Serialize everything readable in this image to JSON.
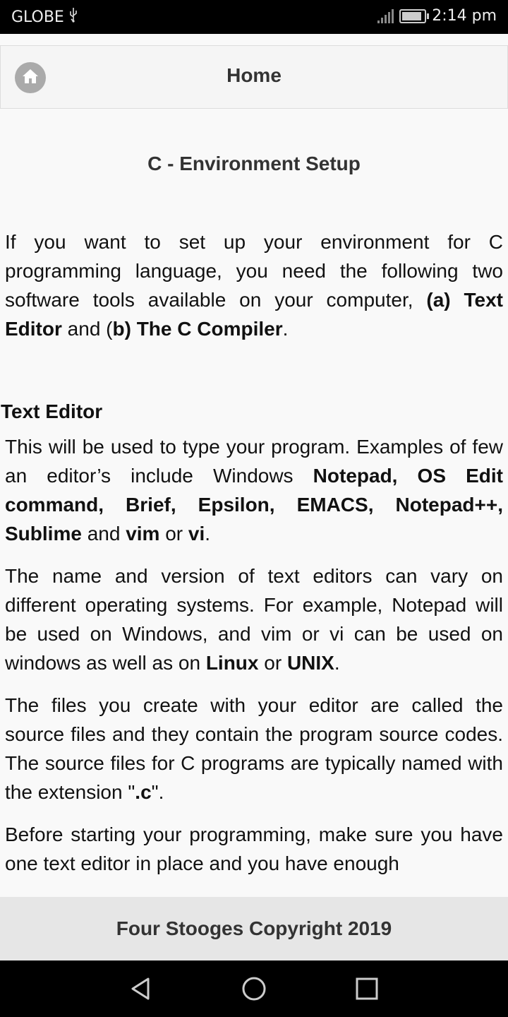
{
  "status_bar": {
    "carrier": "GLOBE",
    "time": "2:14 pm",
    "battery_level": 0.9
  },
  "header": {
    "title": "Home",
    "home_icon": "home-icon"
  },
  "article": {
    "title": "C - Environment Setup",
    "intro": {
      "t1": "If you want to set up your environment for C programming language, you need the following two software tools available on your computer, ",
      "b1": "(a) Text Editor",
      "t2": " and (",
      "b2": "b) The C Compiler",
      "t3": "."
    },
    "section_heading": "Text Editor",
    "p1": {
      "t1": "This will be used to type your program. Examples of few an editor’s include Windows ",
      "b1": "Notepad, OS Edit command, Brief, Epsilon, EMACS, Notepad++, Sublime",
      "t2": " and ",
      "b2": "vim",
      "t3": " or ",
      "b3": "vi",
      "t4": "."
    },
    "p2": {
      "t1": "The name and version of text editors can vary on different operating systems. For example, Notepad will be used on Windows, and vim or vi can be used on windows as well as on ",
      "b1": "Linux",
      "t2": " or ",
      "b2": "UNIX",
      "t3": "."
    },
    "p3": {
      "t1": "The files you create with your editor are called the source files and they contain the program source codes. The source files for C programs are typically named with the extension \"",
      "b1": ".c",
      "t2": "\"."
    },
    "p4": {
      "t1": "Before starting your programming, make sure you have one text editor in place and you have enough"
    }
  },
  "footer": {
    "text": "Four Stooges Copyright 2019"
  },
  "nav_bar": {
    "back_icon": "back-triangle-icon",
    "home_icon": "home-circle-icon",
    "recents_icon": "recents-square-icon"
  }
}
